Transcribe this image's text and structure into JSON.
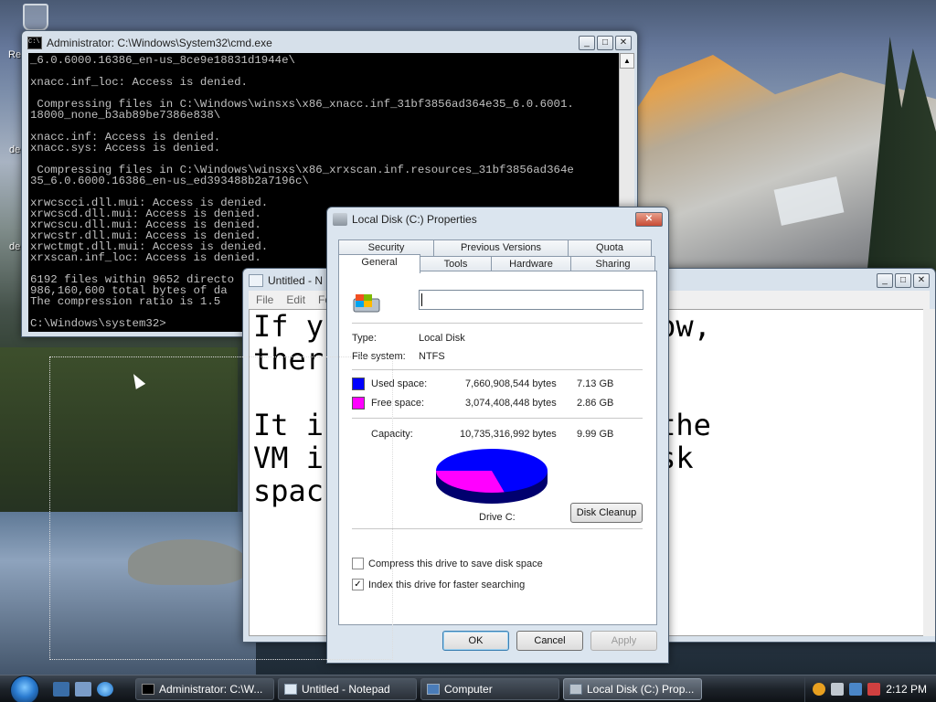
{
  "desktop": {
    "edge_labels": [
      "Re",
      "de",
      "de"
    ]
  },
  "cmd": {
    "title": "Administrator: C:\\Windows\\System32\\cmd.exe",
    "lines": [
      "_6.0.6000.16386_en-us_8ce9e18831d1944e\\",
      "",
      "xnacc.inf_loc: Access is denied.",
      "",
      " Compressing files in C:\\Windows\\winsxs\\x86_xnacc.inf_31bf3856ad364e35_6.0.6001.",
      "18000_none_b3ab89be7386e838\\",
      "",
      "xnacc.inf: Access is denied.",
      "xnacc.sys: Access is denied.",
      "",
      " Compressing files in C:\\Windows\\winsxs\\x86_xrxscan.inf.resources_31bf3856ad364e",
      "35_6.0.6000.16386_en-us_ed393488b2a7196c\\",
      "",
      "xrwcscci.dll.mui: Access is denied.",
      "xrwcscd.dll.mui: Access is denied.",
      "xrwcscu.dll.mui: Access is denied.",
      "xrwcstr.dll.mui: Access is denied.",
      "xrwctmgt.dll.mui: Access is denied.",
      "xrxscan.inf_loc: Access is denied.",
      "",
      "6192 files within 9652 directo",
      "986,160,600 total bytes of da",
      "The compression ratio is 1.5",
      "",
      "C:\\Windows\\system32>"
    ]
  },
  "notepad": {
    "title": "Untitled - N",
    "menu": [
      "File",
      "Edit",
      "Fo"
    ],
    "text_lines": [
      "If y           cmd window,",
      "ther                e",
      "",
      "It i           e OS as the",
      "VM i          eed of disk",
      "spac"
    ]
  },
  "props": {
    "title": "Local Disk (C:) Properties",
    "tabs_top": [
      "Security",
      "Previous Versions",
      "Quota"
    ],
    "tabs_bottom": [
      "General",
      "Tools",
      "Hardware",
      "Sharing"
    ],
    "name_value": "",
    "type_label": "Type:",
    "type_value": "Local Disk",
    "fs_label": "File system:",
    "fs_value": "NTFS",
    "used_label": "Used space:",
    "used_bytes": "7,660,908,544 bytes",
    "used_gb": "7.13 GB",
    "free_label": "Free space:",
    "free_bytes": "3,074,408,448 bytes",
    "free_gb": "2.86 GB",
    "capacity_label": "Capacity:",
    "capacity_bytes": "10,735,316,992 bytes",
    "capacity_gb": "9.99 GB",
    "drive_label": "Drive C:",
    "cleanup_label": "Disk Cleanup",
    "compress_label": "Compress this drive to save disk space",
    "compress_checked": false,
    "index_label": "Index this drive for faster searching",
    "index_checked": true,
    "ok_label": "OK",
    "cancel_label": "Cancel",
    "apply_label": "Apply",
    "used_color": "#0000ff",
    "free_color": "#ff00ff",
    "used_fraction": 0.714
  },
  "taskbar": {
    "tasks": [
      "Administrator: C:\\W...",
      "Untitled - Notepad",
      "Computer",
      "Local Disk (C:) Prop..."
    ],
    "clock": "2:12 PM"
  }
}
